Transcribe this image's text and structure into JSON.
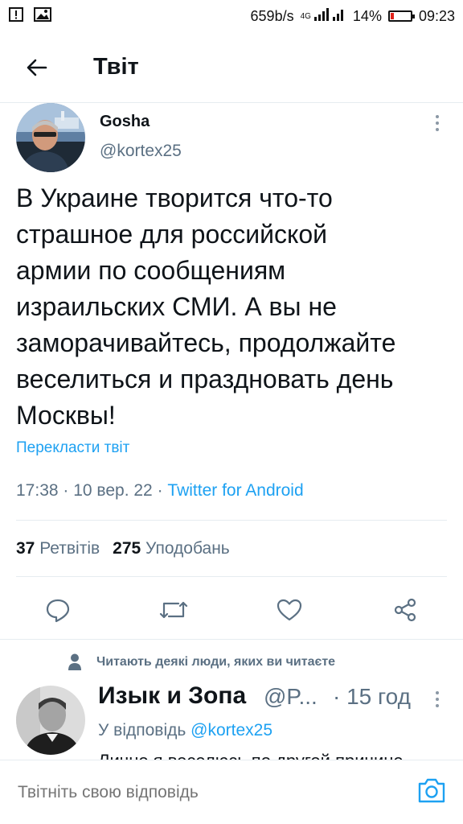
{
  "status_bar": {
    "net_speed": "659b/s",
    "net_type": "4G",
    "battery": "14%",
    "battery_level": 0.14,
    "time": "09:23"
  },
  "header": {
    "title": "Твіт",
    "back_icon": "arrow-left-icon"
  },
  "tweet": {
    "author_name": "Gosha",
    "author_handle": "@kortex25",
    "text_lines": [
      "В Украине творится что-то",
      "страшное для российской",
      "армии по сообщениям",
      "израильских СМИ. А вы не",
      "заморачивайтесь, продолжайте",
      "веселиться и праздновать день",
      "Москвы!"
    ],
    "translate_link": "Перекласти твіт",
    "time": "17:38",
    "date": "10 вер. 22",
    "source": "Twitter for Android",
    "retweets_count": "37",
    "retweets_label": "Ретвітів",
    "likes_count": "275",
    "likes_label": "Уподобань"
  },
  "reply": {
    "social_context": "Читають деякі люди, яких ви читаєте",
    "author_name": "Изык и Зопа",
    "author_handle": "@P...",
    "time": "· 15 год",
    "replying_to_label": "У відповідь",
    "replying_to_handle": "@kortex25",
    "text_preview": "Лично я веселюсь по другой причине"
  },
  "composer": {
    "placeholder": "Твітніть свою відповідь"
  },
  "colors": {
    "accent": "#1da1f2",
    "secondary_text": "#5b7083",
    "divider": "#e6ecf0",
    "battery_low": "#e0231b"
  }
}
